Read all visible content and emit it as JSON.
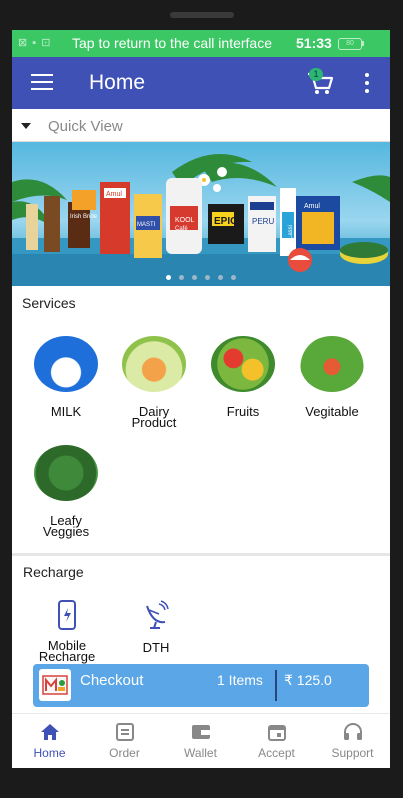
{
  "status_bar": {
    "call_text": "Tap to return to the call interface",
    "time": "51:33",
    "battery": "80"
  },
  "app_bar": {
    "title": "Home",
    "cart_count": "1"
  },
  "quick_view": {
    "label": "Quick View"
  },
  "services": {
    "title": "Services",
    "items": [
      {
        "label": "MILK",
        "icon": "milk-icon"
      },
      {
        "label": "Dairy Product",
        "line1": "Dairy",
        "line2": "Product",
        "icon": "dairy-icon"
      },
      {
        "label": "Fruits",
        "icon": "fruits-icon"
      },
      {
        "label": "Vegitable",
        "icon": "vegetable-icon"
      },
      {
        "label": "Leafy Veggies",
        "line1": "Leafy",
        "line2": "Veggies",
        "icon": "leafy-icon"
      }
    ]
  },
  "banner": {
    "brand_texts": [
      "Amul",
      "MASTI",
      "KOOL",
      "Café",
      "EPIC",
      "PERU",
      "Lassi",
      "Irish Bride",
      "Amul"
    ],
    "dots": 6,
    "active_dot": 0
  },
  "recharge": {
    "title": "Recharge",
    "items": [
      {
        "label": "Mobile Recharge",
        "line1": "Mobile",
        "line2": "Recharge",
        "icon": "mobile-icon"
      },
      {
        "label": "DTH",
        "icon": "satellite-dish-icon"
      }
    ]
  },
  "checkout": {
    "label": "Checkout",
    "items": "1 Items",
    "amount": "₹ 125.0"
  },
  "bottom_nav": [
    {
      "label": "Home",
      "icon": "home-icon",
      "active": true
    },
    {
      "label": "Order",
      "icon": "order-icon",
      "active": false
    },
    {
      "label": "Wallet",
      "icon": "wallet-icon",
      "active": false
    },
    {
      "label": "Accept",
      "icon": "calendar-icon",
      "active": false
    },
    {
      "label": "Support",
      "icon": "headset-icon",
      "active": false
    }
  ],
  "colors": {
    "primary": "#3f51b5",
    "status_green": "#3cc765",
    "checkout_blue": "#5aa6e6"
  }
}
